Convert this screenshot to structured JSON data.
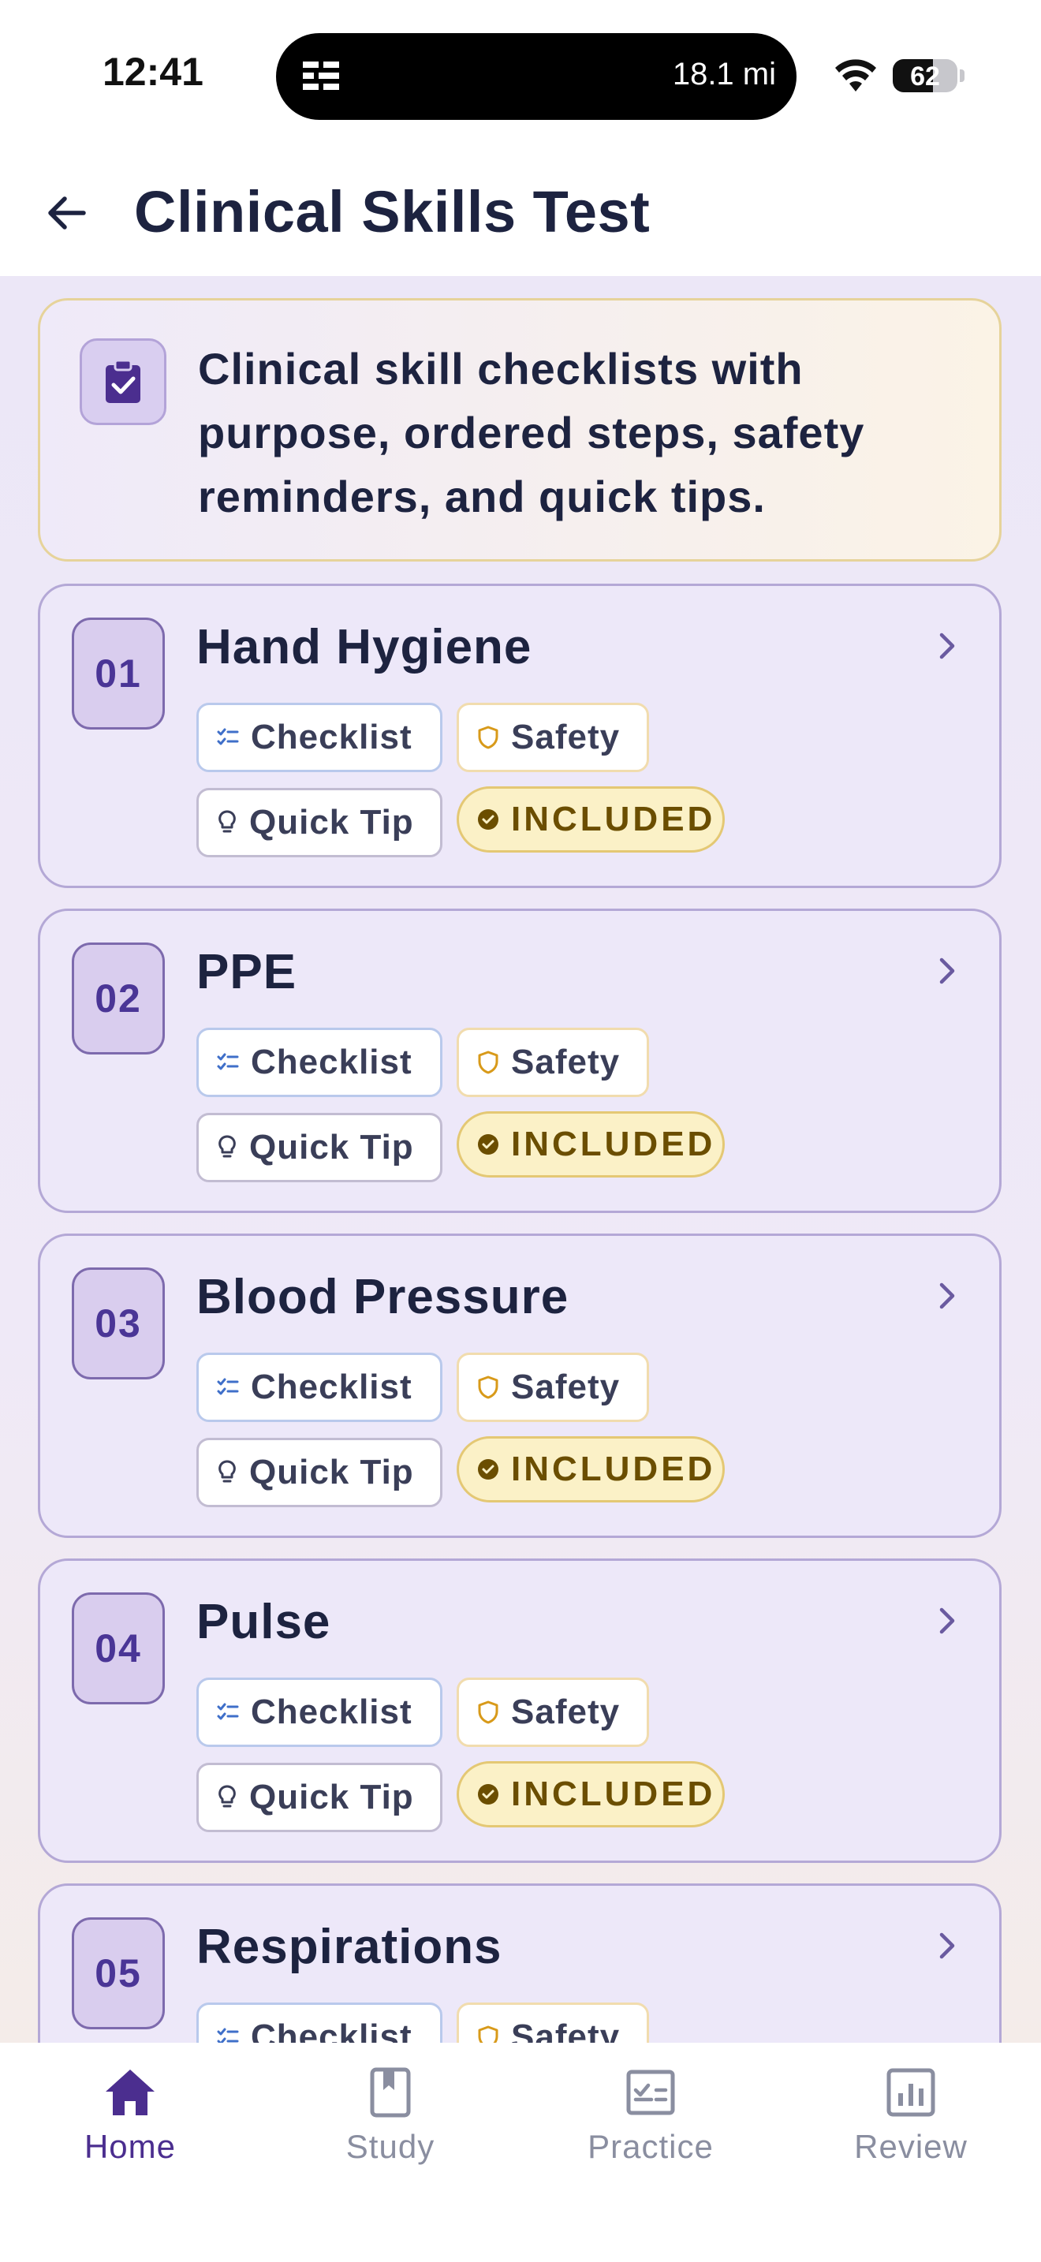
{
  "status_bar": {
    "time": "12:41",
    "distance": "18.1 mi",
    "battery": "62",
    "battery_level": 0.62
  },
  "header": {
    "title": "Clinical Skills Test"
  },
  "intro": {
    "text": "Clinical skill checklists with purpose, ordered steps, safety reminders, and quick tips."
  },
  "chips": {
    "checklist": "Checklist",
    "safety": "Safety",
    "quick_tip": "Quick Tip",
    "included": "INCLUDED"
  },
  "skills": [
    {
      "number": "01",
      "name": "Hand Hygiene"
    },
    {
      "number": "02",
      "name": "PPE"
    },
    {
      "number": "03",
      "name": "Blood Pressure"
    },
    {
      "number": "04",
      "name": "Pulse"
    },
    {
      "number": "05",
      "name": "Respirations"
    }
  ],
  "nav": [
    {
      "label": "Home",
      "icon": "home-icon",
      "active": true
    },
    {
      "label": "Study",
      "icon": "book-icon",
      "active": false
    },
    {
      "label": "Practice",
      "icon": "practice-icon",
      "active": false
    },
    {
      "label": "Review",
      "icon": "chart-icon",
      "active": false
    }
  ],
  "colors": {
    "accent": "#4b2e8f",
    "included": "#6b4e00",
    "safety": "#d89a1a",
    "checklist": "#3f6fc9"
  }
}
